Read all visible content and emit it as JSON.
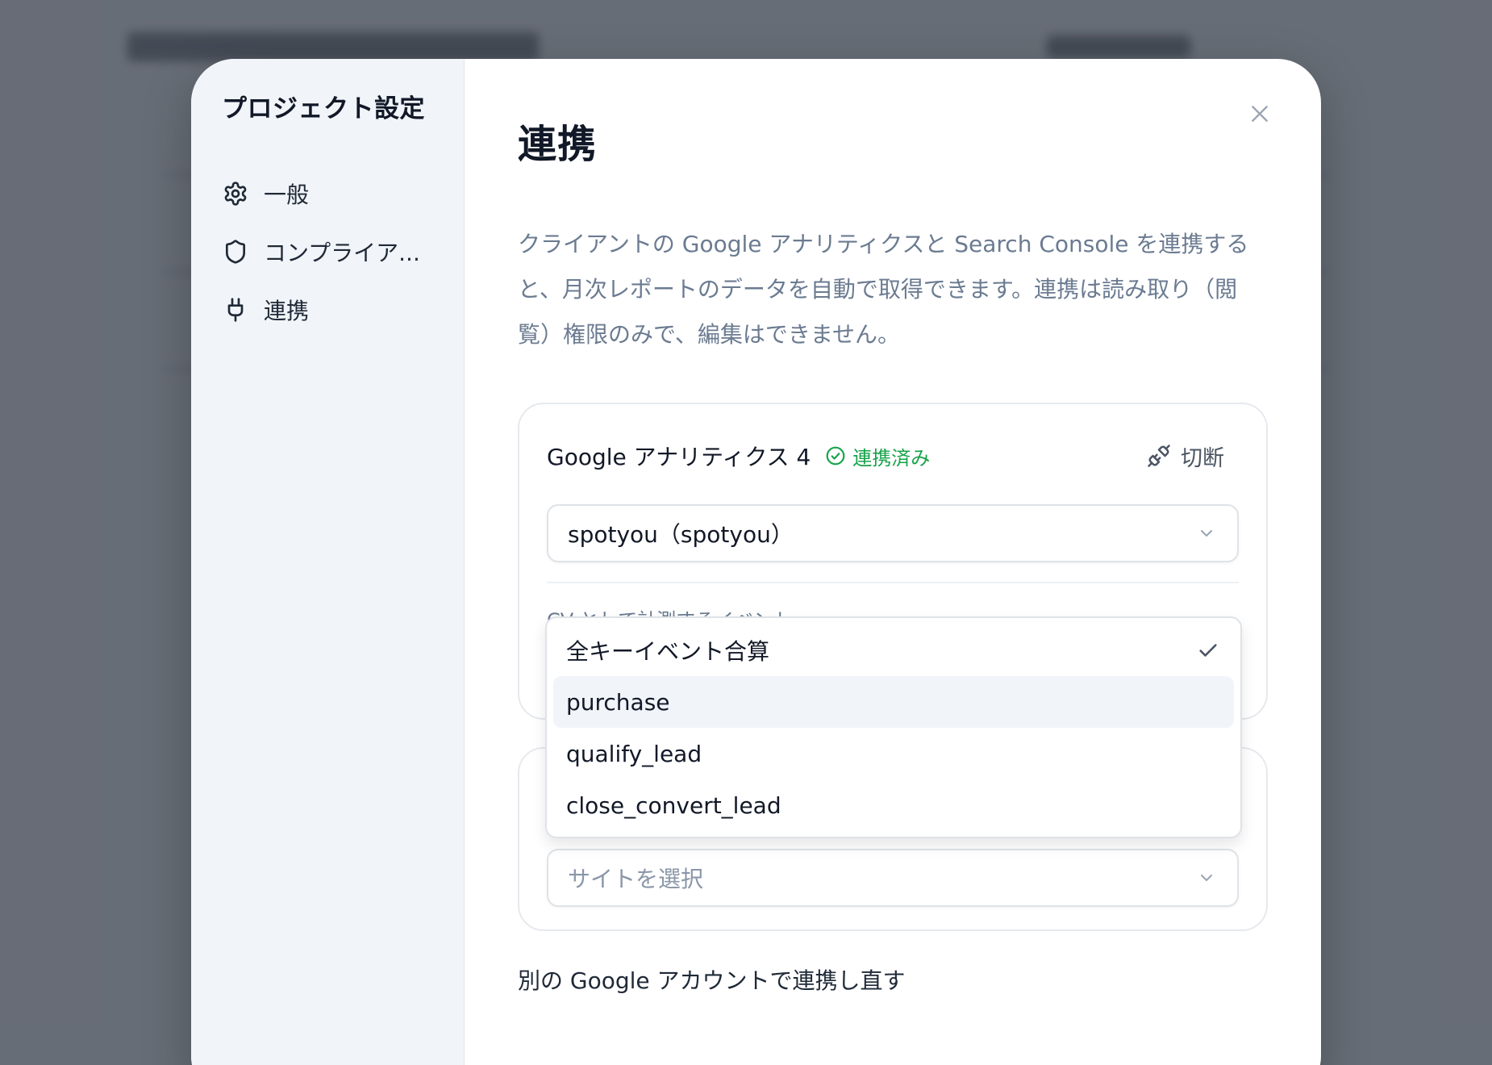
{
  "sidebar": {
    "title": "プロジェクト設定",
    "items": [
      {
        "label": "一般",
        "icon": "gear-icon"
      },
      {
        "label": "コンプライア...",
        "icon": "shield-icon"
      },
      {
        "label": "連携",
        "icon": "plug-icon"
      }
    ]
  },
  "main": {
    "title": "連携",
    "description": "クライアントの Google アナリティクスと Search Console を連携すると、月次レポートのデータを自動で取得できます。連携は読み取り（閲覧）権限のみで、編集はできません。",
    "ga": {
      "title": "Google アナリティクス 4",
      "status": "連携済み",
      "status_color": "#16a34a",
      "disconnect_label": "切断",
      "property_value": "spotyou（spotyou）",
      "cv_label": "CV として計測するイベント"
    },
    "search_console": {
      "site_placeholder": "サイトを選択"
    },
    "relink_label": "別の Google アカウントで連携し直す"
  },
  "dropdown": {
    "options": [
      {
        "label": "全キーイベント合算",
        "selected": true
      },
      {
        "label": "purchase",
        "highlighted": true
      },
      {
        "label": "qualify_lead"
      },
      {
        "label": "close_convert_lead"
      }
    ]
  }
}
